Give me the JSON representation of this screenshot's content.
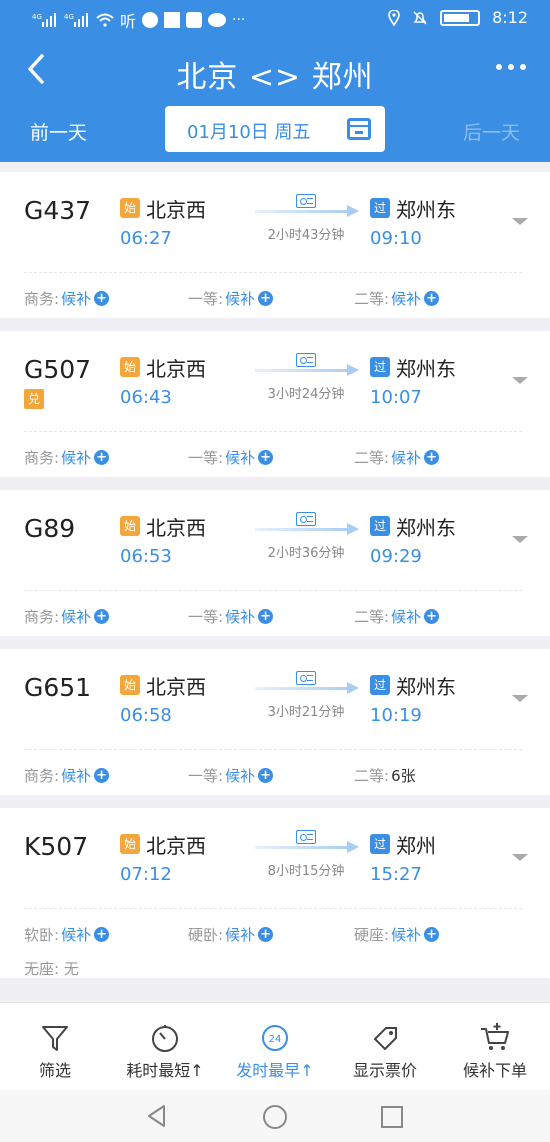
{
  "status": {
    "left_text": "听",
    "time": "8:12"
  },
  "nav": {
    "title": "北京 <> 郑州"
  },
  "date": {
    "prev": "前一天",
    "current": "01月10日 周五",
    "next": "后一天"
  },
  "trains": [
    {
      "no": "G437",
      "dui": "",
      "from_tag": "始",
      "from": "北京西",
      "dep": "06:27",
      "duration": "2小时43分钟",
      "to_tag": "过",
      "to": "郑州东",
      "arr": "09:10",
      "seats": [
        {
          "label": "商务:",
          "value": "候补",
          "plus": true
        },
        {
          "label": "一等:",
          "value": "候补",
          "plus": true
        },
        {
          "label": "二等:",
          "value": "候补",
          "plus": true
        }
      ],
      "extra": null
    },
    {
      "no": "G507",
      "dui": "兑",
      "from_tag": "始",
      "from": "北京西",
      "dep": "06:43",
      "duration": "3小时24分钟",
      "to_tag": "过",
      "to": "郑州东",
      "arr": "10:07",
      "seats": [
        {
          "label": "商务:",
          "value": "候补",
          "plus": true
        },
        {
          "label": "一等:",
          "value": "候补",
          "plus": true
        },
        {
          "label": "二等:",
          "value": "候补",
          "plus": true
        }
      ],
      "extra": null
    },
    {
      "no": "G89",
      "dui": "",
      "from_tag": "始",
      "from": "北京西",
      "dep": "06:53",
      "duration": "2小时36分钟",
      "to_tag": "过",
      "to": "郑州东",
      "arr": "09:29",
      "seats": [
        {
          "label": "商务:",
          "value": "候补",
          "plus": true
        },
        {
          "label": "一等:",
          "value": "候补",
          "plus": true
        },
        {
          "label": "二等:",
          "value": "候补",
          "plus": true
        }
      ],
      "extra": null
    },
    {
      "no": "G651",
      "dui": "",
      "from_tag": "始",
      "from": "北京西",
      "dep": "06:58",
      "duration": "3小时21分钟",
      "to_tag": "过",
      "to": "郑州东",
      "arr": "10:19",
      "seats": [
        {
          "label": "商务:",
          "value": "候补",
          "plus": true
        },
        {
          "label": "一等:",
          "value": "候补",
          "plus": true
        },
        {
          "label": "二等:",
          "value": "6张",
          "plus": false
        }
      ],
      "extra": null
    },
    {
      "no": "K507",
      "dui": "",
      "from_tag": "始",
      "from": "北京西",
      "dep": "07:12",
      "duration": "8小时15分钟",
      "to_tag": "过",
      "to": "郑州",
      "arr": "15:27",
      "seats": [
        {
          "label": "软卧:",
          "value": "候补",
          "plus": true
        },
        {
          "label": "硬卧:",
          "value": "候补",
          "plus": true
        },
        {
          "label": "硬座:",
          "value": "候补",
          "plus": true
        }
      ],
      "extra": {
        "label": "无座:",
        "value": "无"
      }
    }
  ],
  "tabs": [
    {
      "label": "筛选",
      "icon": "filter-icon"
    },
    {
      "label": "耗时最短↑",
      "icon": "timer-icon"
    },
    {
      "label": "发时最早↑",
      "icon": "clock-24-icon",
      "active": true,
      "icon_text": "24"
    },
    {
      "label": "显示票价",
      "icon": "price-tag-icon"
    },
    {
      "label": "候补下单",
      "icon": "cart-add-icon"
    }
  ],
  "colors": {
    "primary": "#3a8fe5",
    "orange": "#f3a63c"
  }
}
